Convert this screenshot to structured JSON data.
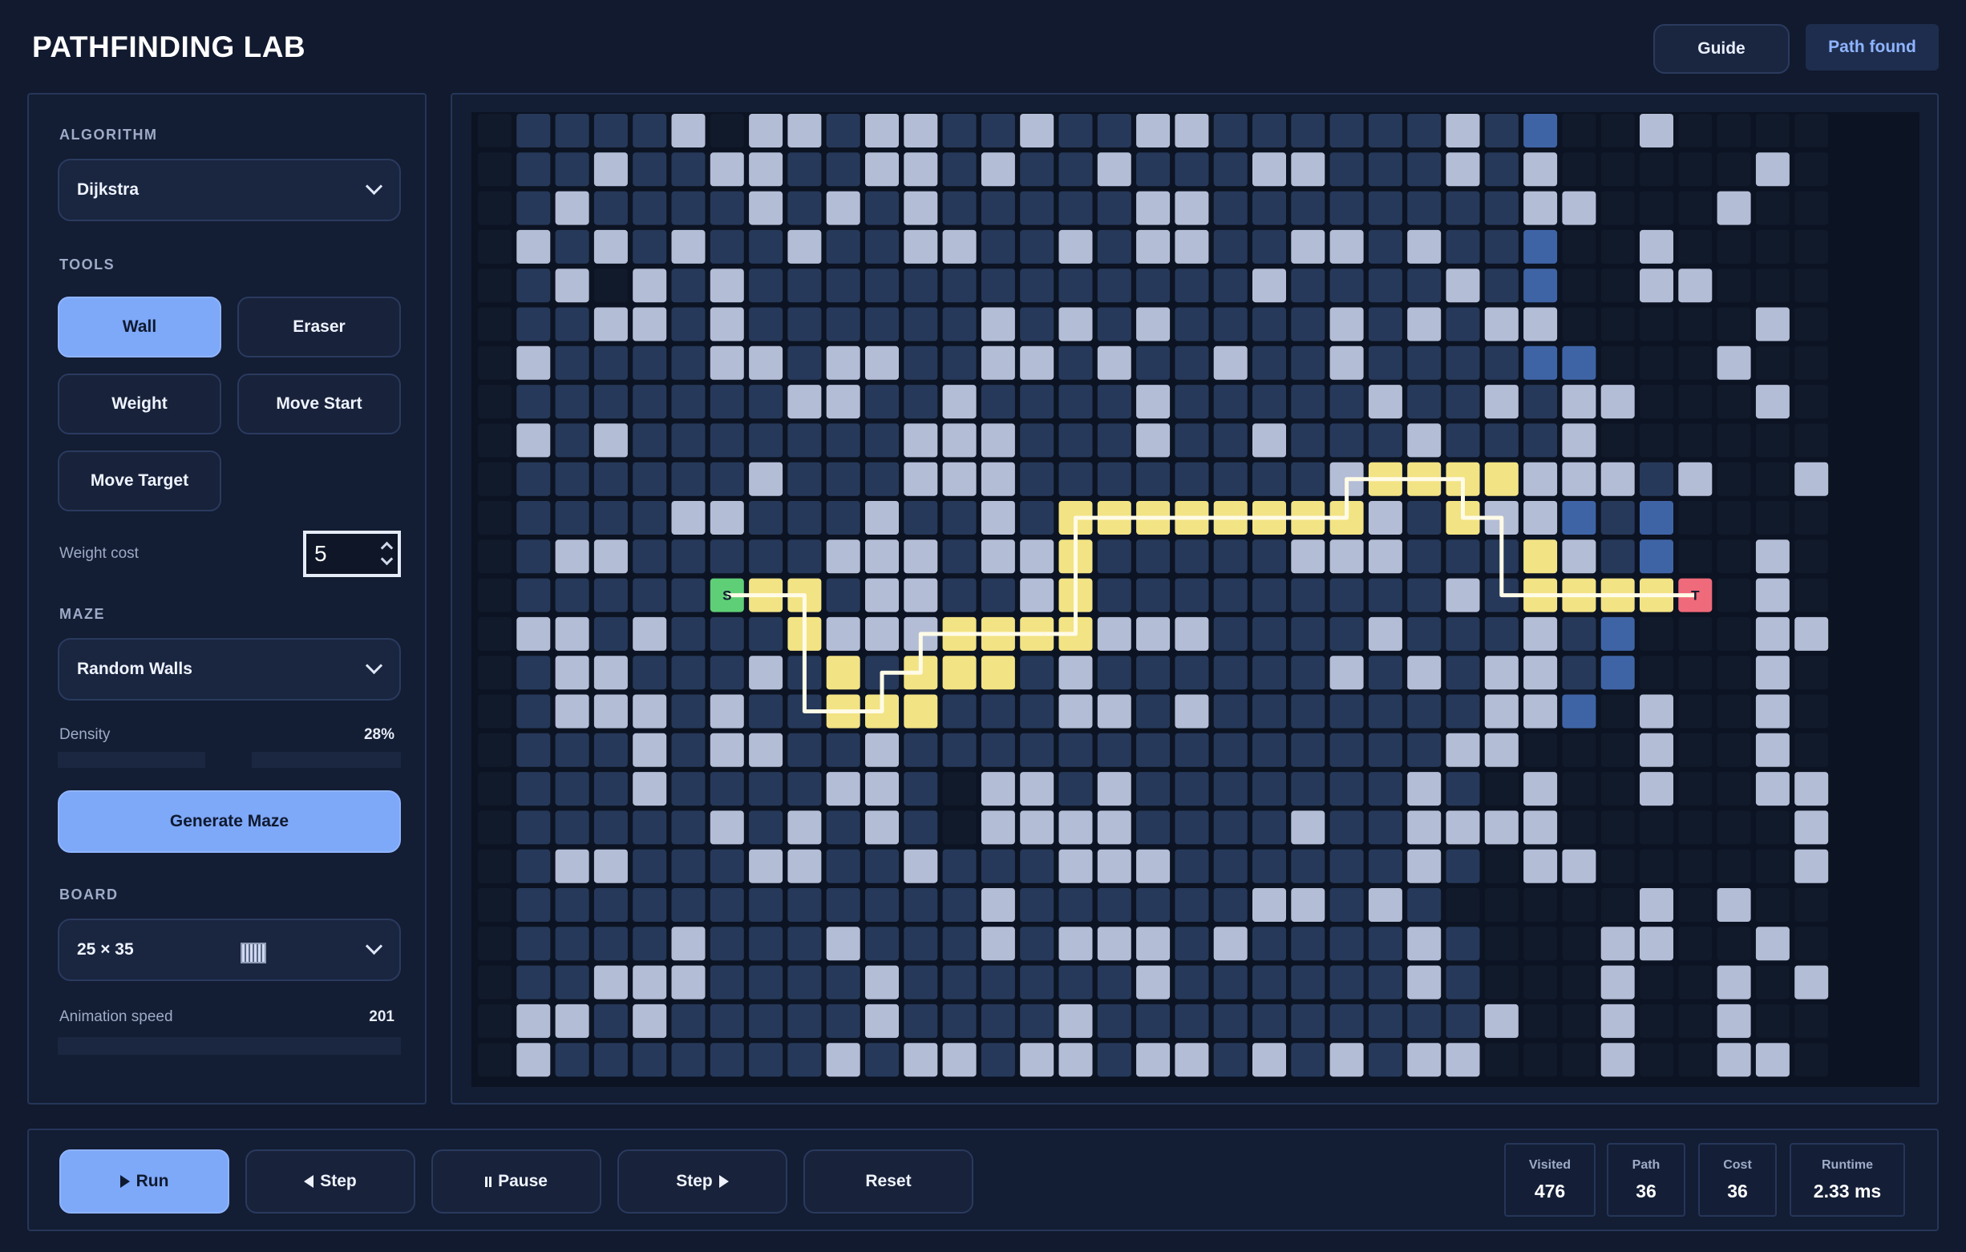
{
  "header": {
    "title": "PATHFINDING LAB",
    "guide_label": "Guide",
    "status": "Path found"
  },
  "sidebar": {
    "algorithm_label": "ALGORITHM",
    "algorithm_value": "Dijkstra",
    "tools_label": "TOOLS",
    "tools": [
      "Wall",
      "Eraser",
      "Weight",
      "Move Start",
      "Move Target"
    ],
    "active_tool": "Wall",
    "weight_cost_label": "Weight cost",
    "weight_cost_value": "5",
    "maze_label": "MAZE",
    "maze_value": "Random Walls",
    "density_label": "Density",
    "density_value": "28%",
    "generate_label": "Generate Maze",
    "board_label": "BOARD",
    "board_value": "25 × 35",
    "speed_label": "Animation speed",
    "speed_value": "201"
  },
  "grid": {
    "start_label": "S",
    "target_label": "T",
    "legend_colors": {
      "unvisited": "#111a2b",
      "visited": "#26395a",
      "frontier": "#3f64a6",
      "wall": "#b3bdd6",
      "path": "#f2e384",
      "start": "#5fcf77",
      "target": "#ef6a7a"
    },
    "rows": [
      ".VVVVW.WWVWWVVWVVWWVVVVVVWVF..W....",
      ".VVWVVWWVVWWVWVVWVVVWWVVVWVW.....W.",
      ".VWVVVVWVWVWVVVVVWWVVVVVVVVWW...W..",
      ".WVWVWVVWVVWWVVWVWWVVWWVWVVF..W....",
      ".VW.WVWVVVVVVVVVVVVVWVVVVWVF..WW...",
      ".VVWWVWVVVVVVWVWVWVVVVWVWVWW.....W.",
      ".WVVVVWWVWWVVWWVWVVWVVWVVVVFF...W..",
      ".VVVVVVVWWVVWVVVVWVVVVVWVVWVWW...W.",
      ".WVWVVVVVVVWWWVVVWVVWVVVWVVVW......",
      ".VVVVVVWVVVWWWVVVVVVVVWPPPPWWWVW..W",
      ".VVVVWWVVVWVVWVPPPPPPPPWVPWWFVF....",
      ".VWWVVVVVWWWVWWPVVVVVWWWVVVPWVF..W.",
      ".VVVVVSPPVWWVVWPVVVVVVVVVWVPPPPT.W.",
      ".WWVWVVVPWWWPPPPWWWVVVVWVVVWVF...WW",
      ".VWWVVVWVPVPPPVWVVVVVVWVWVWWVF...W.",
      ".VWWWVWVVPPPVVVWWVWVVVVVVVWWF.W..W.",
      ".VVVWVWWVVWVVVVVVVVVVVVVVWW...W..W.",
      ".VVVWVVVVWWV.WWVWVVVVVVVWV.W..W..WW",
      ".VVVVVWVWVWV.WWWWVVVVWVVWWWW......W",
      ".VWWVVVWWVVWVVVWWWVVVVVVWV.WW.....W",
      ".VVVVVVVVVVVVWVVVVVVWWVWV.....W.W..",
      ".VVVVWVVVWVVVWVWWWVWVVVVWV...WW..W.",
      ".VVWWWVVVVWVVVVVVWVVVVVVWV...W..W.W",
      ".WWVWVVVVVWVVVVWVVVVVVVVVVW..W..W..",
      ".WVVVVVVVWVWWVWWVWWVWVWVWW...W..WW."
    ],
    "path_cells": [
      [
        12,
        6
      ],
      [
        12,
        7
      ],
      [
        12,
        8
      ],
      [
        13,
        8
      ],
      [
        14,
        8
      ],
      [
        15,
        8
      ],
      [
        15,
        9
      ],
      [
        15,
        10
      ],
      [
        14,
        10
      ],
      [
        14,
        11
      ],
      [
        13,
        11
      ],
      [
        13,
        12
      ],
      [
        13,
        13
      ],
      [
        13,
        14
      ],
      [
        13,
        15
      ],
      [
        12,
        15
      ],
      [
        11,
        15
      ],
      [
        10,
        15
      ],
      [
        10,
        16
      ],
      [
        10,
        17
      ],
      [
        10,
        18
      ],
      [
        10,
        19
      ],
      [
        10,
        20
      ],
      [
        10,
        21
      ],
      [
        10,
        22
      ],
      [
        9,
        22
      ],
      [
        9,
        23
      ],
      [
        9,
        24
      ],
      [
        9,
        25
      ],
      [
        10,
        25
      ],
      [
        10,
        26
      ],
      [
        11,
        26
      ],
      [
        12,
        26
      ],
      [
        12,
        27
      ],
      [
        12,
        28
      ],
      [
        12,
        29
      ],
      [
        12,
        30
      ],
      [
        12,
        31
      ]
    ]
  },
  "controls": {
    "run_label": "Run",
    "step_back_label": "Step",
    "pause_label": "Pause",
    "step_forward_label": "Step",
    "reset_label": "Reset"
  },
  "stats": [
    {
      "label": "Visited",
      "value": "476"
    },
    {
      "label": "Path",
      "value": "36"
    },
    {
      "label": "Cost",
      "value": "36"
    },
    {
      "label": "Runtime",
      "value": "2.33 ms"
    }
  ]
}
